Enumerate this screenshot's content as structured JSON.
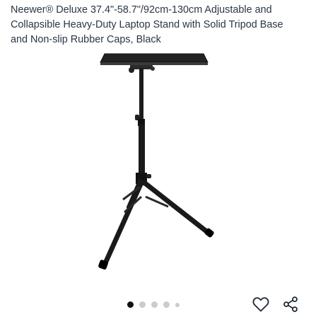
{
  "product": {
    "title": "Neewer® Deluxe 37.4\"-58.7\"/92cm-130cm Adjustable and Collapsible Heavy-Duty Laptop Stand with Solid Tripod Base and Non-slip Rubber Caps, Black"
  },
  "carousel": {
    "dots": 5,
    "active_index": 0
  },
  "actions": {
    "wishlist_icon": "heart-outline-icon",
    "share_icon": "share-icon"
  },
  "colors": {
    "text": "#2b3644",
    "dot_active": "#111111",
    "dot_inactive": "#c9cccf",
    "stand": "#1a1a1a"
  }
}
